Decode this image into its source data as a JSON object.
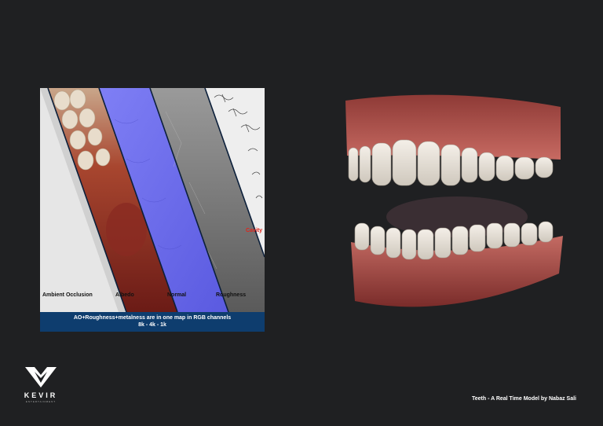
{
  "texture_panel": {
    "strips": {
      "ambient_occlusion": "Ambient Occlusion",
      "albedo": "Albedo",
      "normal": "Normal",
      "roughness": "Roughness",
      "cavity": "Cavity"
    },
    "caption_line1": "AO+Roughness+metalness are in one map in RGB channels",
    "caption_line2": "8k - 4k - 1k"
  },
  "logo": {
    "word": "KEVIR",
    "sub": "ENTERTAINMENT"
  },
  "credit": "Teeth - A Real Time Model by Nabaz Sali",
  "colors": {
    "background": "#1f2022",
    "caption_bar": "#0e3d6e",
    "normal_map": "#6c6cf0",
    "cavity_label": "#e2231a"
  }
}
